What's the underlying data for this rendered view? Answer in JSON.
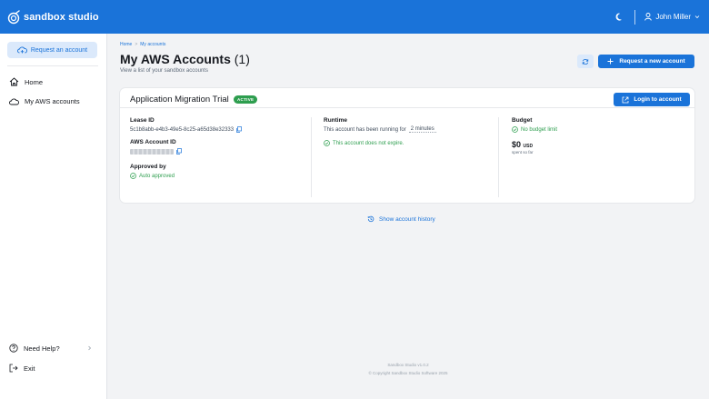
{
  "app": {
    "brand": "sandbox studio"
  },
  "user": {
    "name": "John Miller"
  },
  "sidebar": {
    "request_label": "Request an account",
    "items": [
      {
        "label": "Home",
        "icon": "home-icon"
      },
      {
        "label": "My AWS accounts",
        "icon": "cloud-icon"
      }
    ],
    "bottom": [
      {
        "label": "Need Help?",
        "icon": "help-icon"
      },
      {
        "label": "Exit",
        "icon": "exit-icon"
      }
    ]
  },
  "breadcrumb": [
    "Home",
    "My accounts"
  ],
  "page": {
    "title": "My AWS Accounts",
    "count": "(1)",
    "subtitle": "View a list of your sandbox accounts",
    "new_button": "Request a new account"
  },
  "account": {
    "name": "Application Migration Trial",
    "status": "ACTIVE",
    "login_button": "Login to account",
    "lease_id_label": "Lease ID",
    "lease_id": "5c1b8abb-e4b3-49e5-8c25-a65d38e32333",
    "aws_id_label": "AWS Account ID",
    "approved_label": "Approved by",
    "approved_value": "Auto approved",
    "runtime_label": "Runtime",
    "runtime_text": "This account has been running for",
    "runtime_value": "2 minutes",
    "expiry_text": "This account does not expire.",
    "budget_label": "Budget",
    "budget_value": "No budget limit",
    "spent_amount": "$0",
    "spent_currency": "USD",
    "spent_label": "spent so far"
  },
  "history_link": "Show account history",
  "footer": {
    "version": "Sandbox Studio v1.0.2",
    "copyright": "© Copyright Sandbox Studio Software 2025"
  },
  "colors": {
    "primary": "#1a73d9",
    "success": "#2e9e4f",
    "background": "#f2f3f5"
  }
}
